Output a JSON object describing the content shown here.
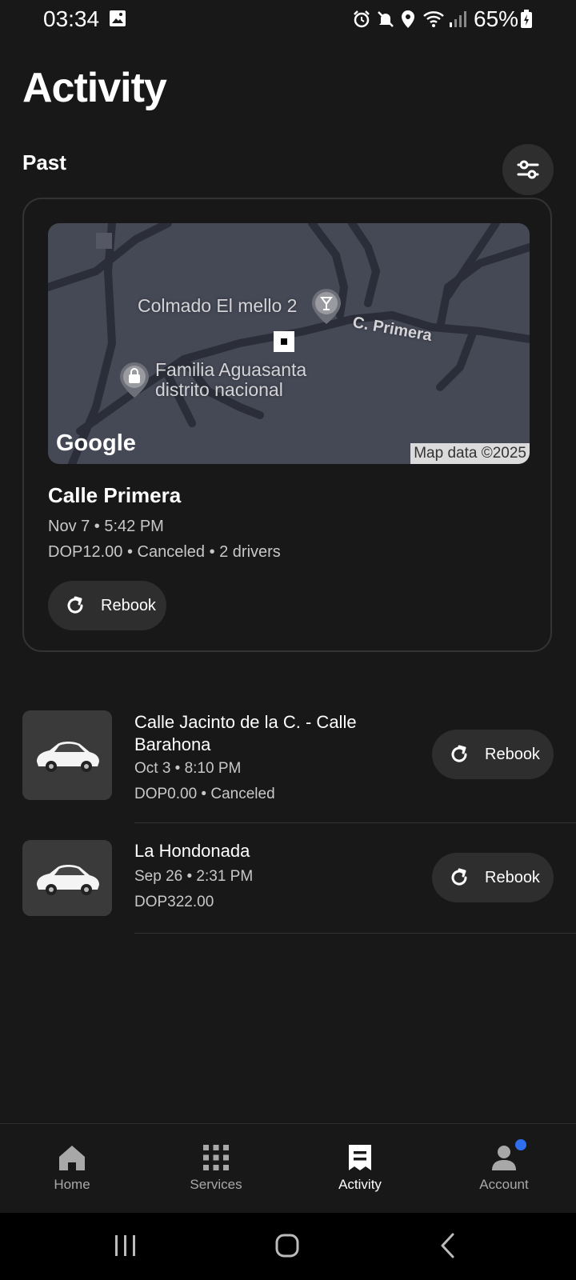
{
  "status_bar": {
    "time": "03:34",
    "battery_percent": "65%",
    "icons": [
      "gallery-icon",
      "alarm-icon",
      "mute-icon",
      "location-icon",
      "wifi-icon",
      "signal-icon",
      "battery-icon"
    ]
  },
  "header": {
    "title": "Activity"
  },
  "section": {
    "label": "Past",
    "filter_icon": "sliders-icon"
  },
  "featured_trip": {
    "map": {
      "labels": {
        "poi_1": "Colmado El mello 2",
        "street": "C. Primera",
        "poi_2_line1": "Familia Aguasanta",
        "poi_2_line2": "distrito nacional"
      },
      "logo": "Google",
      "attribution": "Map data ©2025"
    },
    "title": "Calle Primera",
    "datetime": "Nov 7 • 5:42 PM",
    "details": "DOP12.00 • Canceled • 2 drivers",
    "rebook_label": "Rebook"
  },
  "past_trips": [
    {
      "title_line1": "Calle Jacinto de la C. - Calle",
      "title_line2": "Barahona",
      "datetime": "Oct 3 • 8:10 PM",
      "details": "DOP0.00 • Canceled",
      "rebook_label": "Rebook"
    },
    {
      "title_line1": "La Hondonada",
      "datetime": "Sep 26 • 2:31 PM",
      "details": "DOP322.00",
      "rebook_label": "Rebook"
    }
  ],
  "bottom_nav": {
    "items": [
      {
        "label": "Home",
        "icon": "home-icon"
      },
      {
        "label": "Services",
        "icon": "grid-icon"
      },
      {
        "label": "Activity",
        "icon": "receipt-icon",
        "active": true
      },
      {
        "label": "Account",
        "icon": "person-icon",
        "badge": true
      }
    ]
  },
  "colors": {
    "background": "#181818",
    "surface": "#2e2e2e",
    "badge": "#2f6fed"
  }
}
